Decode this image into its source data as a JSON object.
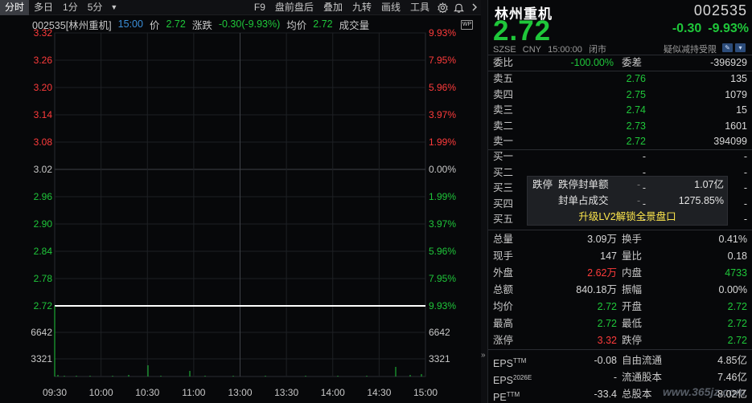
{
  "toolbar": {
    "items": [
      "分时",
      "多日",
      "1分",
      "5分"
    ],
    "right_items": [
      "F9",
      "盘前盘后",
      "叠加",
      "九转",
      "画线",
      "工具"
    ]
  },
  "chart_head": {
    "code_name": "002535[林州重机]",
    "time": "15:00",
    "price_label": "价",
    "price": "2.72",
    "change_label": "涨跌",
    "change": "-0.30(-9.93%)",
    "avg_label": "均价",
    "avg": "2.72",
    "volume_label": "成交量",
    "wp_icon": "WP"
  },
  "chart_data": {
    "type": "line",
    "x_ticks": [
      "09:30",
      "10:00",
      "10:30",
      "11:00",
      "13:00",
      "13:30",
      "14:00",
      "14:30",
      "15:00"
    ],
    "price_ticks": [
      "3.32",
      "3.26",
      "3.20",
      "3.14",
      "3.08",
      "3.02",
      "2.96",
      "2.90",
      "2.84",
      "2.78",
      "2.72"
    ],
    "pct_ticks": [
      "9.93%",
      "7.95%",
      "5.96%",
      "3.97%",
      "1.99%",
      "0.00%",
      "1.99%",
      "3.97%",
      "5.96%",
      "7.95%",
      "9.93%"
    ],
    "volume_ticks": [
      "6642",
      "3321"
    ],
    "prev_close": 3.02,
    "ylim": [
      2.72,
      3.32
    ],
    "series": [
      {
        "values": [
          2.72,
          2.72,
          2.72,
          2.72,
          2.72,
          2.72,
          2.72,
          2.72,
          2.72
        ]
      }
    ],
    "colors": {
      "up": "#ff3b3b",
      "down": "#1fc73a",
      "line": "#ffffff",
      "neutral": "#c8c8c8"
    }
  },
  "quote": {
    "name": "林州重机",
    "code": "002535",
    "price": "2.72",
    "change": "-0.30",
    "change_pct": "-9.93%",
    "market": "SZSE",
    "currency": "CNY",
    "time": "15:00:00",
    "status": "闭市",
    "reduce_note": "疑似减持受限"
  },
  "order_ratio": {
    "label": "委比",
    "value": "-100.00%",
    "diff_label": "委差",
    "diff": "-396929"
  },
  "asks": [
    {
      "label": "卖五",
      "price": "2.76",
      "vol": "135"
    },
    {
      "label": "卖四",
      "price": "2.75",
      "vol": "1079"
    },
    {
      "label": "卖三",
      "price": "2.74",
      "vol": "15"
    },
    {
      "label": "卖二",
      "price": "2.73",
      "vol": "1601"
    },
    {
      "label": "卖一",
      "price": "2.72",
      "vol": "394099"
    }
  ],
  "bids": [
    {
      "label": "买一",
      "price": "-",
      "vol": "-"
    },
    {
      "label": "买二",
      "price": "-",
      "vol": "-"
    },
    {
      "label": "买三",
      "price": "-",
      "vol": "-"
    },
    {
      "label": "买四",
      "price": "-",
      "vol": "-"
    },
    {
      "label": "买五",
      "price": "-",
      "vol": "-"
    }
  ],
  "popup": {
    "tag": "跌停",
    "r1_label": "跌停封单额",
    "r1_dash": "-",
    "r1_value": "1.07亿",
    "r2_label": "封单占成交",
    "r2_dash": "-",
    "r2_value": "1275.85%",
    "upgrade": "升级LV2解锁全景盘口"
  },
  "stats": [
    {
      "l1": "总量",
      "v1": "3.09万",
      "c1": "white",
      "l2": "换手",
      "v2": "0.41%",
      "c2": "white"
    },
    {
      "l1": "现手",
      "v1": "147",
      "c1": "white",
      "l2": "量比",
      "v2": "0.18",
      "c2": "white"
    },
    {
      "l1": "外盘",
      "v1": "2.62万",
      "c1": "red",
      "l2": "内盘",
      "v2": "4733",
      "c2": "green"
    },
    {
      "l1": "总额",
      "v1": "840.18万",
      "c1": "white",
      "l2": "振幅",
      "v2": "0.00%",
      "c2": "white"
    },
    {
      "l1": "均价",
      "v1": "2.72",
      "c1": "green",
      "l2": "开盘",
      "v2": "2.72",
      "c2": "green"
    },
    {
      "l1": "最高",
      "v1": "2.72",
      "c1": "green",
      "l2": "最低",
      "v2": "2.72",
      "c2": "green"
    },
    {
      "l1": "涨停",
      "v1": "3.32",
      "c1": "red",
      "l2": "跌停",
      "v2": "2.72",
      "c2": "green"
    }
  ],
  "fin": [
    {
      "l1": "EPS",
      "sup1": "TTM",
      "v1": "-0.08",
      "l2": "自由流通",
      "v2": "4.85亿"
    },
    {
      "l1": "EPS",
      "sup1": "2026E",
      "v1": "-",
      "l2": "流通股本",
      "v2": "7.46亿"
    },
    {
      "l1": "PE",
      "sup1": "TTM",
      "v1": "-33.4",
      "l2": "总股本",
      "v2": "8.02亿"
    }
  ],
  "watermark": "www.365jz.com"
}
